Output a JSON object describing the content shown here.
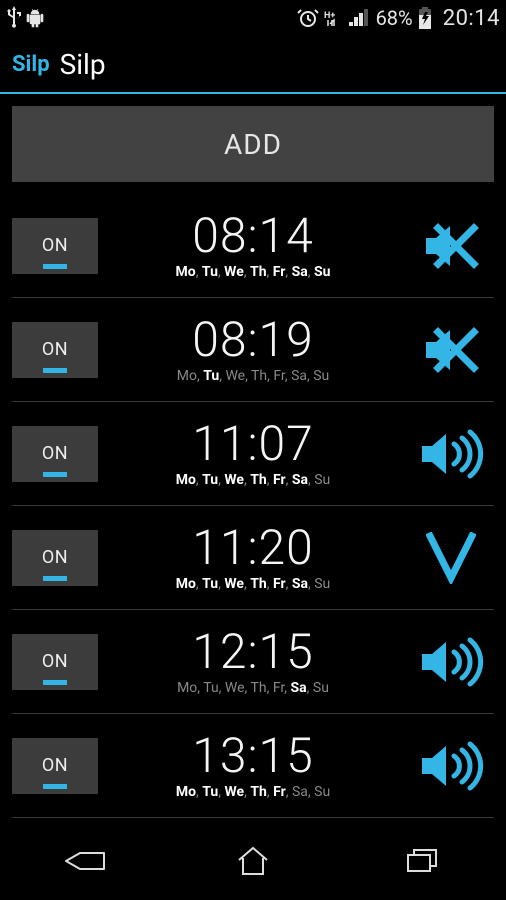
{
  "status": {
    "battery_pct": "68%",
    "time": "20:14"
  },
  "header": {
    "brand": "Silp",
    "title": "Silp"
  },
  "add_button": {
    "label": "ADD"
  },
  "toggle_label": "ON",
  "days_short": [
    "Mo",
    "Tu",
    "We",
    "Th",
    "Fr",
    "Sa",
    "Su"
  ],
  "rows": [
    {
      "time": "08:14",
      "active_days": [
        0,
        1,
        2,
        3,
        4,
        5,
        6
      ],
      "mode": "mute"
    },
    {
      "time": "08:19",
      "active_days": [
        1
      ],
      "mode": "mute"
    },
    {
      "time": "11:07",
      "active_days": [
        0,
        1,
        2,
        3,
        4,
        5
      ],
      "mode": "sound"
    },
    {
      "time": "11:20",
      "active_days": [
        0,
        1,
        2,
        3,
        4,
        5
      ],
      "mode": "vibrate"
    },
    {
      "time": "12:15",
      "active_days": [
        5
      ],
      "mode": "sound"
    },
    {
      "time": "13:15",
      "active_days": [
        0,
        1,
        2,
        3,
        4
      ],
      "mode": "sound"
    }
  ],
  "colors": {
    "accent": "#33b5e5"
  }
}
